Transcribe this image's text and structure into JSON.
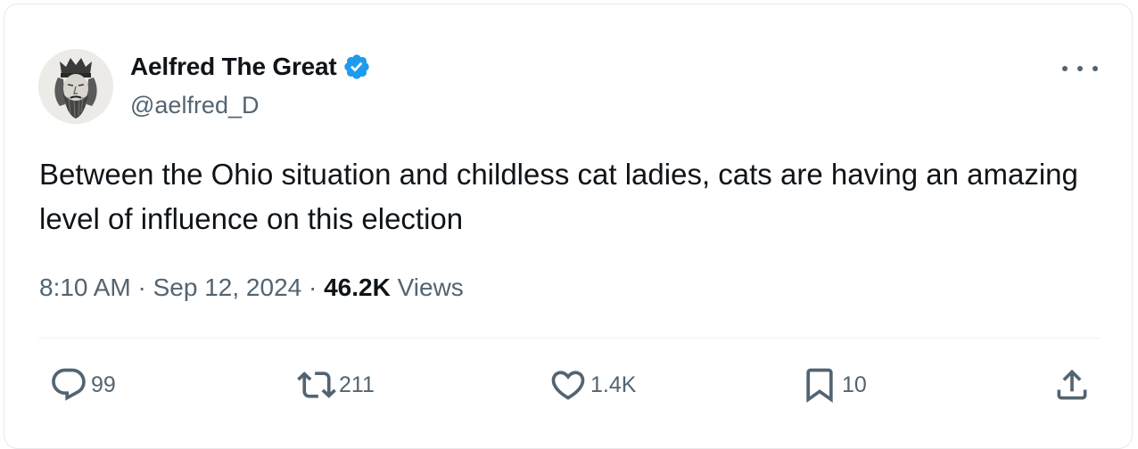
{
  "author": {
    "display_name": "Aelfred The Great",
    "handle": "@aelfred_D",
    "verified": true,
    "avatar_icon": "crowned-king-portrait"
  },
  "tweet": {
    "text": "Between the Ohio situation and childless cat ladies, cats are having an amazing level of influence on this election",
    "time": "8:10 AM",
    "date": "Sep 12, 2024",
    "separator": "·",
    "views_count": "46.2K",
    "views_label": "Views"
  },
  "actions": {
    "replies": "99",
    "retweets": "211",
    "likes": "1.4K",
    "bookmarks": "10"
  },
  "colors": {
    "text_primary": "#0f1419",
    "text_secondary": "#536471",
    "verified_blue": "#1d9bf0",
    "divider": "#eff3f4"
  }
}
